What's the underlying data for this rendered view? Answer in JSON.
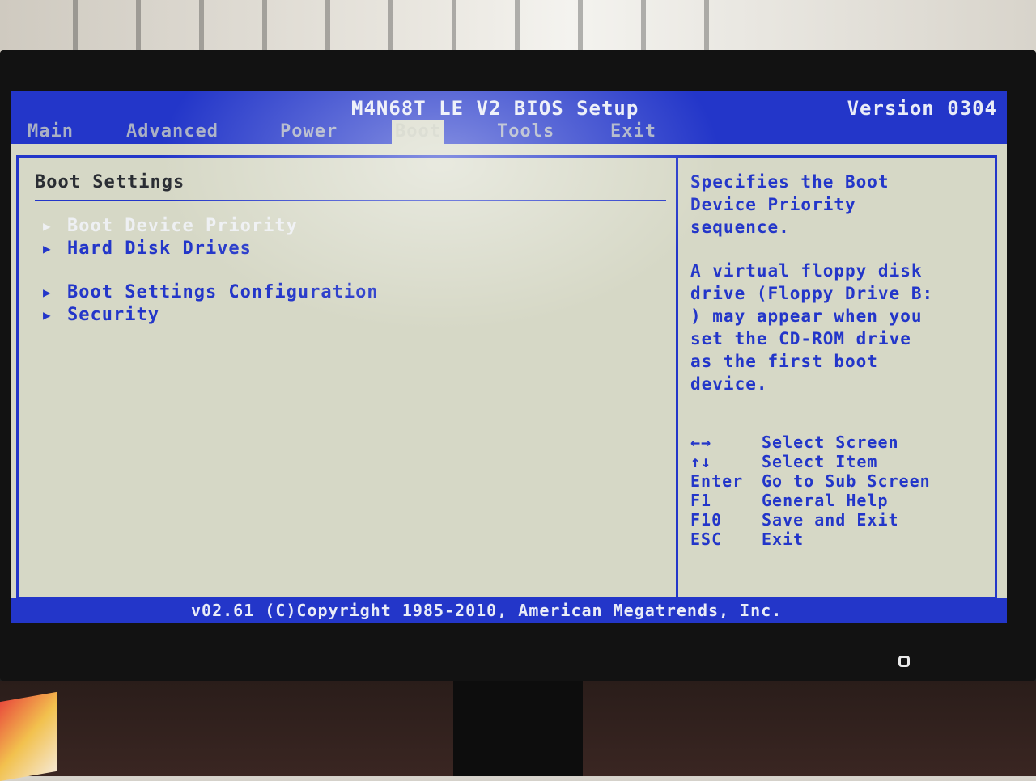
{
  "header": {
    "title": "M4N68T LE V2 BIOS Setup",
    "version": "Version 0304"
  },
  "tabs": [
    {
      "label": "Main"
    },
    {
      "label": "Advanced"
    },
    {
      "label": "Power"
    },
    {
      "label": "Boot",
      "active": true
    },
    {
      "label": "Tools"
    },
    {
      "label": "Exit"
    }
  ],
  "boot_panel": {
    "title": "Boot Settings",
    "items": [
      {
        "label": "Boot Device Priority",
        "highlighted": true
      },
      {
        "label": "Hard Disk Drives"
      },
      {
        "label": "Boot Settings Configuration"
      },
      {
        "label": "Security"
      }
    ]
  },
  "help": {
    "paragraph_1": "Specifies the Boot\nDevice Priority\nsequence.",
    "paragraph_2": "A virtual floppy disk\ndrive (Floppy Drive B:\n) may appear when you\nset the CD-ROM drive\nas the first boot\ndevice."
  },
  "keys": [
    {
      "key": "←→",
      "desc": "Select Screen"
    },
    {
      "key": "↑↓",
      "desc": "Select Item"
    },
    {
      "key": "Enter",
      "desc": "Go to Sub Screen"
    },
    {
      "key": "F1",
      "desc": "General Help"
    },
    {
      "key": "F10",
      "desc": "Save and Exit"
    },
    {
      "key": "ESC",
      "desc": "Exit"
    }
  ],
  "footer": {
    "text": "v02.61 (C)Copyright 1985-2010, American Megatrends, Inc."
  },
  "colors": {
    "bios_blue": "#2336c9",
    "bios_bg": "#d6d8c6",
    "highlight_text": "#eef0f3"
  }
}
